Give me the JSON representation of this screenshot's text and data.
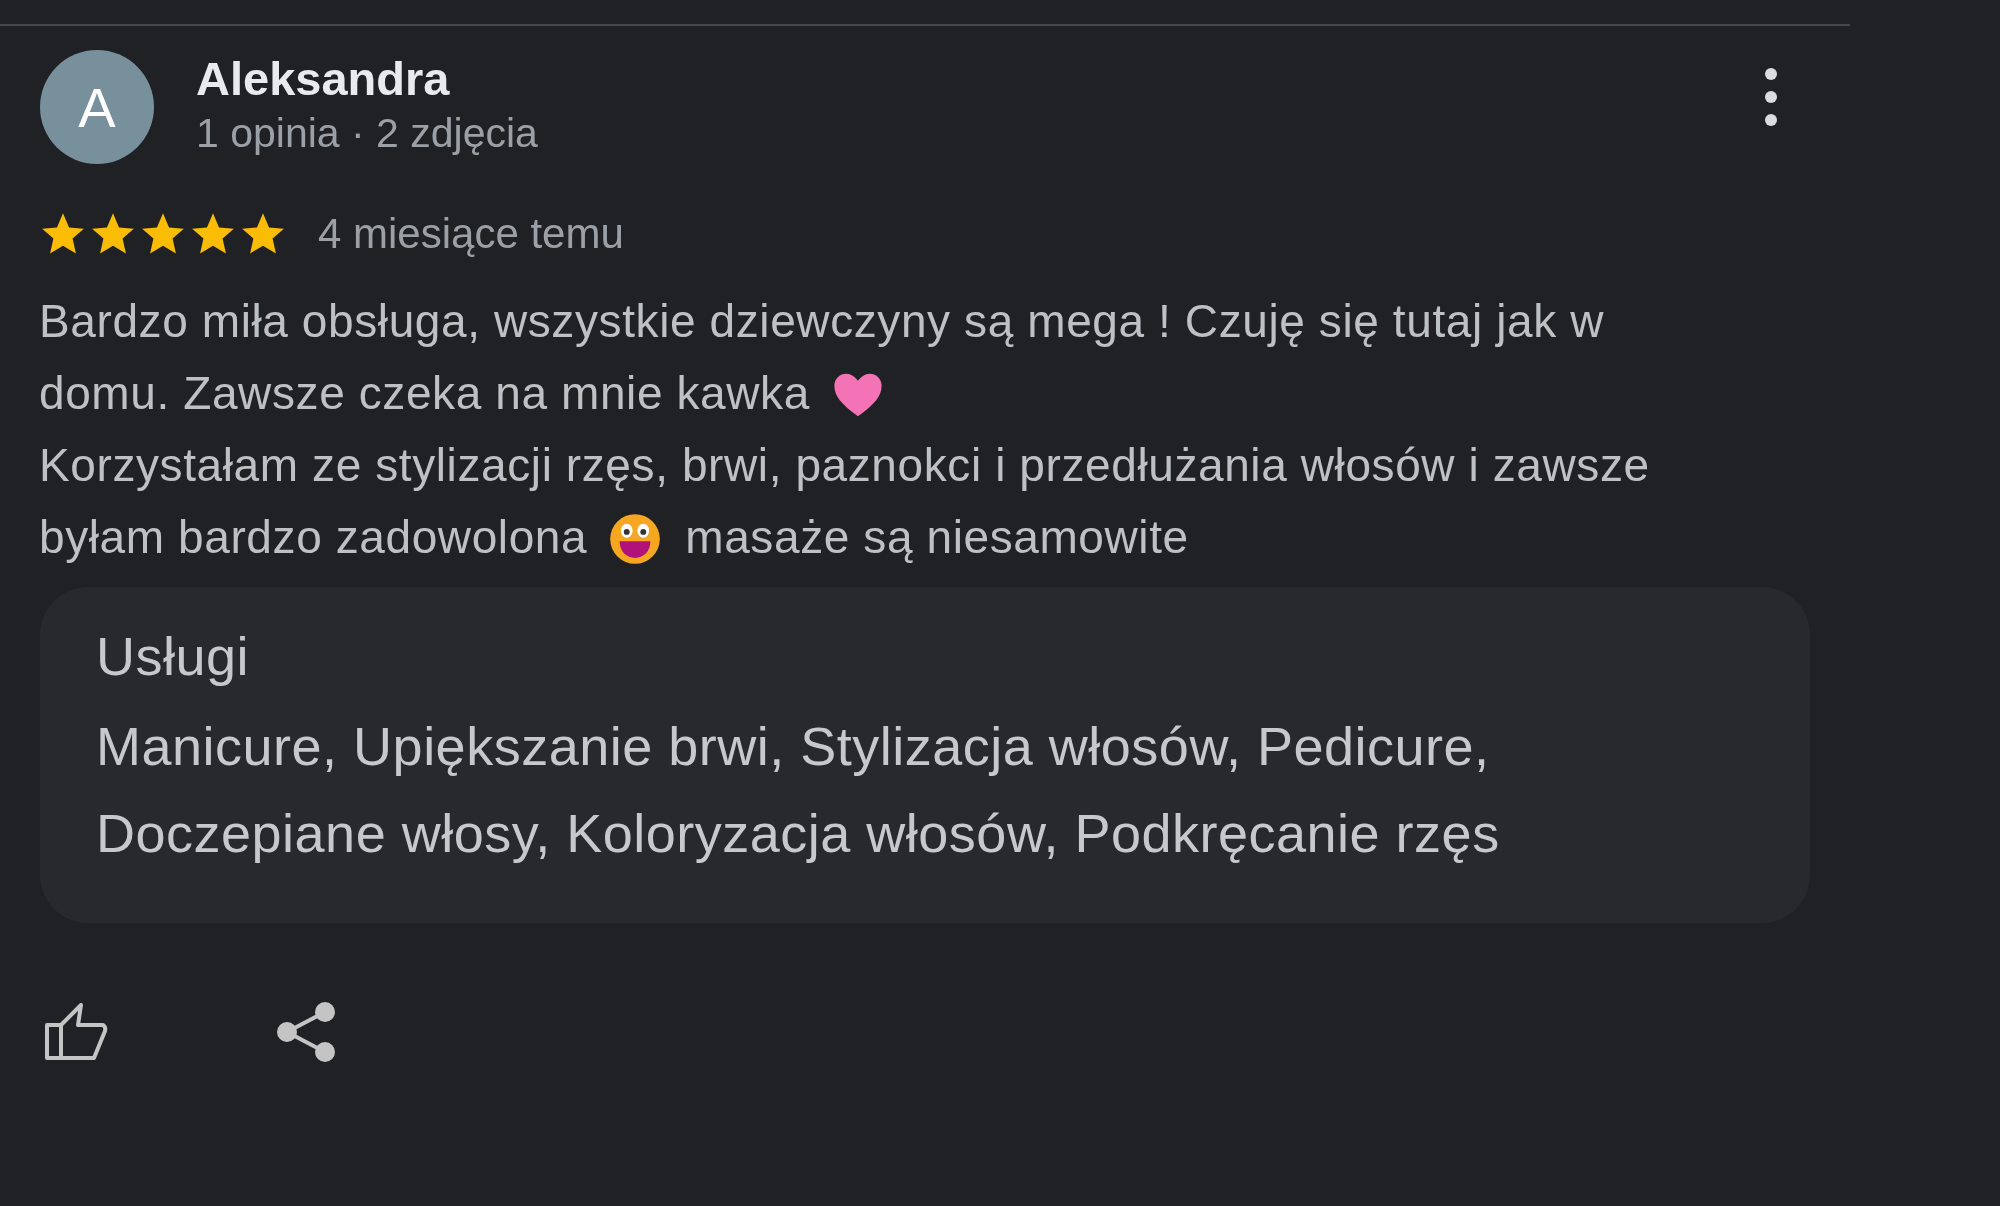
{
  "review": {
    "author": {
      "initial": "A",
      "name": "Aleksandra",
      "meta": "1 opinia · 2 zdjęcia"
    },
    "stars": 5,
    "time": "4 miesiące temu",
    "lines": [
      [
        {
          "kind": "text",
          "text": "Bardzo miła obsługa, wszystkie dziewczyny są mega ! Czuję się tutaj jak w"
        }
      ],
      [
        {
          "kind": "text",
          "text": "domu. Zawsze czeka na mnie kawka"
        },
        {
          "kind": "heart"
        }
      ],
      [
        {
          "kind": "text",
          "text": "Korzystałam ze stylizacji rzęs, brwi, paznokci i przedłużania włosów i zawsze"
        }
      ],
      [
        {
          "kind": "text",
          "text": "byłam bardzo zadowolona"
        },
        {
          "kind": "grin"
        },
        {
          "kind": "text",
          "text": "masaże są niesamowite"
        }
      ]
    ],
    "services": {
      "title": "Usługi",
      "text": "Manicure, Upiększanie brwi, Stylizacja włosów, Pedicure, Doczepiane włosy, Koloryzacja włosów, Podkręcanie rzęs"
    }
  }
}
